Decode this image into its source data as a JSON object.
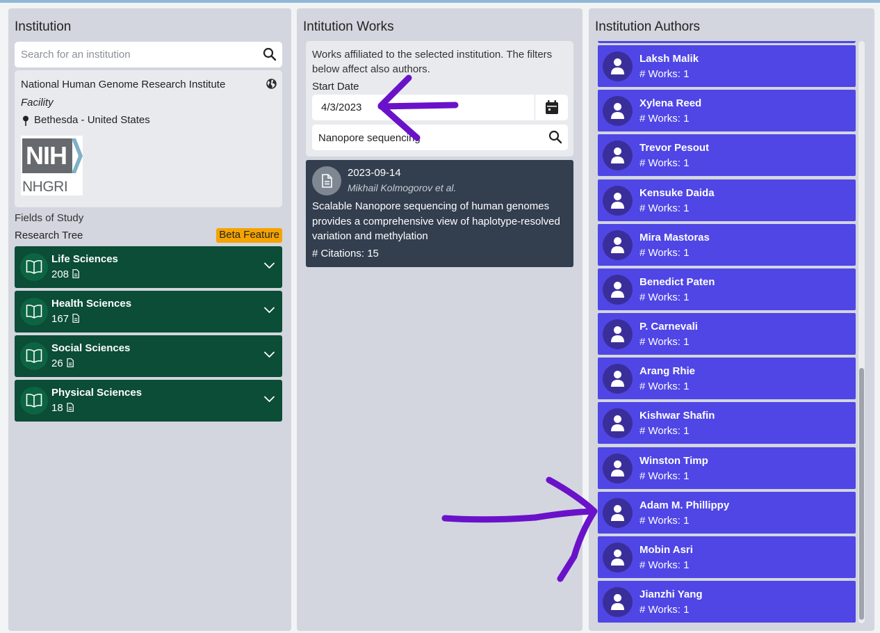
{
  "institution_panel": {
    "title": "Institution",
    "search_placeholder": "Search for an institution",
    "institution": {
      "name": "National Human Genome Research Institute",
      "type": "Facility",
      "location": "Bethesda - United States",
      "logo_text_main": "NIH",
      "logo_text_sub": "NHGRI"
    },
    "fields_of_study_label": "Fields of Study",
    "research_tree_label": "Research Tree",
    "beta_badge": "Beta Feature",
    "fields": [
      {
        "name": "Life Sciences",
        "count": "208"
      },
      {
        "name": "Health Sciences",
        "count": "167"
      },
      {
        "name": "Social Sciences",
        "count": "26"
      },
      {
        "name": "Physical Sciences",
        "count": "18"
      }
    ]
  },
  "works_panel": {
    "title": "Intitution Works",
    "description": "Works affiliated to the selected institution. The filters below affect also authors.",
    "start_date_label": "Start Date",
    "start_date_value": "4/3/2023",
    "keyword_value": "Nanopore sequencing",
    "works": [
      {
        "date": "2023-09-14",
        "authors": "Mikhail Kolmogorov et al.",
        "title": "Scalable Nanopore sequencing of human genomes provides a comprehensive view of haplotype-resolved variation and methylation",
        "citations": "# Citations: 15"
      }
    ]
  },
  "authors_panel": {
    "title": "Institution Authors",
    "authors": [
      {
        "name": "Laksh Malik",
        "works": "# Works: 1"
      },
      {
        "name": "Xylena Reed",
        "works": "# Works: 1"
      },
      {
        "name": "Trevor Pesout",
        "works": "# Works: 1"
      },
      {
        "name": "Kensuke Daida",
        "works": "# Works: 1"
      },
      {
        "name": "Mira Mastoras",
        "works": "# Works: 1"
      },
      {
        "name": "Benedict Paten",
        "works": "# Works: 1"
      },
      {
        "name": "P. Carnevali",
        "works": "# Works: 1"
      },
      {
        "name": "Arang Rhie",
        "works": "# Works: 1"
      },
      {
        "name": "Kishwar Shafin",
        "works": "# Works: 1"
      },
      {
        "name": "Winston Timp",
        "works": "# Works: 1"
      },
      {
        "name": "Adam M. Phillippy",
        "works": "# Works: 1"
      },
      {
        "name": "Mobin Asri",
        "works": "# Works: 1"
      },
      {
        "name": "Jianzhi Yang",
        "works": "# Works: 1"
      }
    ]
  },
  "colors": {
    "field_card": "#0b4d36",
    "author_card": "#4f46e5",
    "work_card": "#333e4f",
    "beta_badge": "#f4a300",
    "annotation_arrow": "#6a12c9"
  },
  "icons": {
    "search": "search-icon",
    "globe": "globe-icon",
    "location": "map-pin-icon",
    "book": "open-book-icon",
    "document": "document-icon",
    "calendar": "calendar-icon",
    "person": "person-icon",
    "expand": "chevron-down-icon"
  }
}
